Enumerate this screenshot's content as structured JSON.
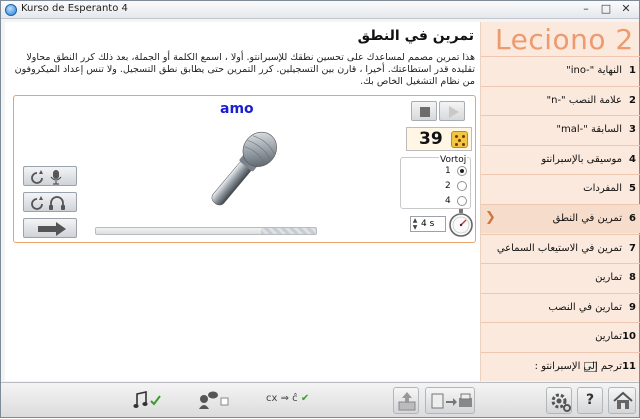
{
  "window": {
    "title": "Kurso de Esperanto 4",
    "controls": {
      "minimize": "–",
      "maximize": "□",
      "close": "✕"
    }
  },
  "exercise": {
    "title": "تمرين في النطق",
    "description": "هذا تمرين مصمم لمساعدك على تحسين نطقك للإسبرانتو. أولا ، اسمع الكلمة أو الجملة، بعد ذلك كرر النطق محاولا تقليده قدر استطاعتك. أخيرا ، قارن بين التسجيلين. كرر التمرين حتى يطابق نطق التسجيل. ولا تنس إعداد الميكروفون من نظام التشغيل الخاص بك.",
    "word": "amo",
    "score": "39",
    "vortoj_label": "Vortoj",
    "vortoj_options": [
      "1",
      "2",
      "4"
    ],
    "vortoj_selected": "1",
    "time_value": "4 s",
    "progress_fraction": 0.25
  },
  "sidebar": {
    "lesson_title": "Leciono 2",
    "items": [
      {
        "num": "1",
        "label": "النهاية \"-ino\""
      },
      {
        "num": "2",
        "label": "علامة النصب \"-n\""
      },
      {
        "num": "3",
        "label": "السابقة \"-mal\""
      },
      {
        "num": "4",
        "label": "موسيقى بالإسبرانتو"
      },
      {
        "num": "5",
        "label": "المفردات"
      },
      {
        "num": "6",
        "label": "تمرين في النطق"
      },
      {
        "num": "7",
        "label": "تمرين في الاستيعاب السماعي"
      },
      {
        "num": "8",
        "label": "تمارين"
      },
      {
        "num": "9",
        "label": "تمارين في النصب"
      },
      {
        "num": "10",
        "label": "تمارين"
      },
      {
        "num": "11",
        "label": "ترجم إلى الإسبرانتو :"
      }
    ],
    "active_index": 5
  },
  "toolbar": {
    "convert_label": "cx ⇒ ĉ",
    "check_mark": "✔",
    "help_label": "?"
  },
  "colors": {
    "accent": "#ee9a6f",
    "sidebar_bg": "#fbe9dd",
    "word": "#1b1fd2",
    "panel_border": "#e9a36c"
  }
}
